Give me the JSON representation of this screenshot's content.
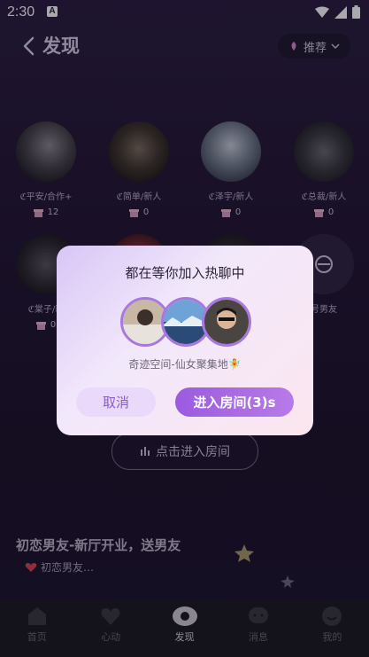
{
  "status_bar": {
    "time": "2:30",
    "notif_letter": "A"
  },
  "header": {
    "title": "发现",
    "sort_label": "推荐"
  },
  "users": [
    {
      "name": "ℭ平安/合作+",
      "gifts": "12"
    },
    {
      "name": "ℭ简单/新人",
      "gifts": "0"
    },
    {
      "name": "ℭ泽宇/新人",
      "gifts": "0"
    },
    {
      "name": "ℭ总裁/新人",
      "gifts": "0"
    },
    {
      "name": "ℭ棠子/新",
      "gifts": "0"
    },
    {
      "name": "",
      "gifts": ""
    },
    {
      "name": "",
      "gifts": ""
    },
    {
      "name": "号男友",
      "gifts": ""
    }
  ],
  "enter_room_button": "点击进入房间",
  "room": {
    "title": "初恋男友-新厅开业，送男友",
    "subtitle": "初恋男友…"
  },
  "dialog": {
    "title": "都在等你加入热聊中",
    "room_name": "奇迹空间-仙女聚集地🧚",
    "cancel": "取消",
    "enter": "进入房间(3)s"
  },
  "tabs": [
    {
      "label": "首页",
      "icon": "home-icon"
    },
    {
      "label": "心动",
      "icon": "heart-icon"
    },
    {
      "label": "发现",
      "icon": "discover-icon",
      "active": true
    },
    {
      "label": "消息",
      "icon": "message-icon"
    },
    {
      "label": "我的",
      "icon": "profile-icon"
    }
  ],
  "colors": {
    "accent": "#9b5be0",
    "background": "#221633"
  }
}
